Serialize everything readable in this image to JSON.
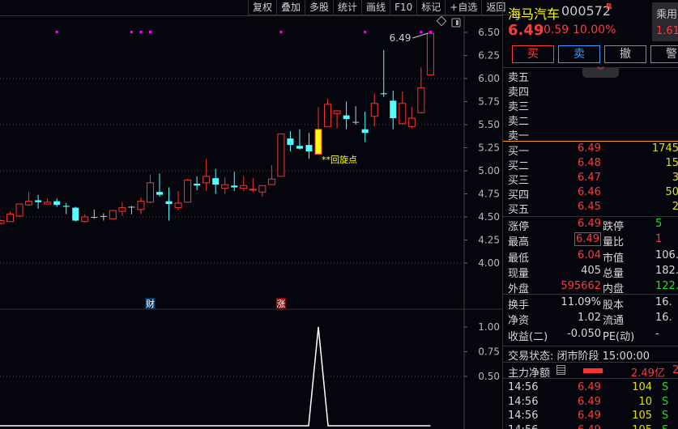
{
  "toolbar": [
    "复权",
    "叠加",
    "多股",
    "统计",
    "画线",
    "F10",
    "标记",
    "+自选",
    "返回"
  ],
  "stock": {
    "name": "海马汽车",
    "code": "000572",
    "flag": "R",
    "price": "6.49",
    "change": "0.59",
    "pct": "10.00%",
    "sector": "乘用",
    "sector_pct": "1.61"
  },
  "actions": {
    "buy": "买",
    "sell": "卖",
    "cancel": "撤",
    "alert": "警"
  },
  "asks": [
    "卖五",
    "卖四",
    "卖三",
    "卖二",
    "卖一"
  ],
  "bids": [
    {
      "label": "买一",
      "price": "6.49",
      "vol": "1745"
    },
    {
      "label": "买二",
      "price": "6.48",
      "vol": "15"
    },
    {
      "label": "买三",
      "price": "6.47",
      "vol": "3"
    },
    {
      "label": "买四",
      "price": "6.46",
      "vol": "50"
    },
    {
      "label": "买五",
      "price": "6.45",
      "vol": "2"
    }
  ],
  "stats1": [
    {
      "l": "涨停",
      "v": "6.49",
      "l2": "跌停",
      "v2": "5"
    },
    {
      "l": "最高",
      "v": "6.49",
      "l2": "量比",
      "v2": "1"
    },
    {
      "l": "最低",
      "v": "6.04",
      "l2": "市值",
      "v2": "106."
    },
    {
      "l": "现量",
      "v": "405",
      "l2": "总量",
      "v2": "182."
    },
    {
      "l": "外盘",
      "v": "595662",
      "l2": "内盘",
      "v2": "122."
    }
  ],
  "stats2": [
    {
      "l": "换手",
      "v": "11.09%",
      "l2": "股本",
      "v2": "16."
    },
    {
      "l": "净资",
      "v": "1.02",
      "l2": "流通",
      "v2": "16."
    },
    {
      "l": "收益(二)",
      "v": "-0.050",
      "l2": "PE(动)",
      "v2": "-"
    }
  ],
  "status": "交易状态: 闭市阶段 15:00:00",
  "mainflow": {
    "label": "主力净额",
    "value": "2.49亿",
    "extra": "2"
  },
  "ticks": [
    {
      "t": "14:56",
      "p": "6.49",
      "v": "104",
      "s": "S"
    },
    {
      "t": "14:56",
      "p": "6.49",
      "v": "10",
      "s": "S"
    },
    {
      "t": "14:56",
      "p": "6.49",
      "v": "105",
      "s": "S"
    },
    {
      "t": "14:56",
      "p": "6.49",
      "v": "105",
      "s": "S"
    }
  ],
  "chart_data": {
    "type": "candlestick",
    "price_axis": {
      "ticks": [
        "6.50",
        "6.25",
        "6.00",
        "5.75",
        "5.50",
        "5.25",
        "5.00",
        "4.75",
        "4.50",
        "4.25",
        "4.00"
      ],
      "range": [
        4.0,
        6.5
      ]
    },
    "last_label": "6.49",
    "annotation": "**回旋点",
    "annotation_index": 34,
    "markers": {
      "cai": "财",
      "zhang": "涨",
      "cai_index": 16,
      "zhang_index": 30
    },
    "dot_indices": [
      6,
      14,
      15,
      16,
      30,
      39,
      45,
      46
    ],
    "candles": [
      [
        4.43,
        4.47,
        4.42,
        4.46
      ],
      [
        4.45,
        4.56,
        4.45,
        4.53
      ],
      [
        4.51,
        4.64,
        4.5,
        4.64
      ],
      [
        4.63,
        4.77,
        4.62,
        4.67
      ],
      [
        4.68,
        4.74,
        4.59,
        4.66
      ],
      [
        4.64,
        4.7,
        4.64,
        4.66
      ],
      [
        4.67,
        4.7,
        4.61,
        4.63
      ],
      [
        4.62,
        4.65,
        4.53,
        4.61
      ],
      [
        4.6,
        4.61,
        4.45,
        4.46
      ],
      [
        4.45,
        4.53,
        4.44,
        4.5
      ],
      [
        4.5,
        4.58,
        4.48,
        4.5
      ],
      [
        4.51,
        4.54,
        4.46,
        4.51
      ],
      [
        4.48,
        4.57,
        4.47,
        4.57
      ],
      [
        4.56,
        4.66,
        4.51,
        4.6
      ],
      [
        4.61,
        4.62,
        4.53,
        4.61
      ],
      [
        4.58,
        4.71,
        4.53,
        4.67
      ],
      [
        4.66,
        4.96,
        4.65,
        4.87
      ],
      [
        4.77,
        4.97,
        4.72,
        4.74
      ],
      [
        4.67,
        4.82,
        4.46,
        4.64
      ],
      [
        4.6,
        4.78,
        4.57,
        4.65
      ],
      [
        4.66,
        4.91,
        4.66,
        4.9
      ],
      [
        4.86,
        4.94,
        4.79,
        4.84
      ],
      [
        4.87,
        5.13,
        4.78,
        4.94
      ],
      [
        4.92,
        5.02,
        4.75,
        4.85
      ],
      [
        4.81,
        4.93,
        4.75,
        4.85
      ],
      [
        4.84,
        4.99,
        4.78,
        4.82
      ],
      [
        4.81,
        4.94,
        4.78,
        4.84
      ],
      [
        4.79,
        4.92,
        4.77,
        4.8
      ],
      [
        4.77,
        4.84,
        4.72,
        4.84
      ],
      [
        4.85,
        5.06,
        4.85,
        4.91
      ],
      [
        4.94,
        5.4,
        4.94,
        5.4
      ],
      [
        5.35,
        5.43,
        5.21,
        5.28
      ],
      [
        5.27,
        5.45,
        5.23,
        5.24
      ],
      [
        5.28,
        5.41,
        5.13,
        5.21
      ],
      [
        5.18,
        5.69,
        5.17,
        5.45
      ],
      [
        5.48,
        5.78,
        5.48,
        5.72
      ],
      [
        5.62,
        5.65,
        5.46,
        5.65
      ],
      [
        5.6,
        5.75,
        5.45,
        5.56
      ],
      [
        5.53,
        5.7,
        5.5,
        5.53
      ],
      [
        5.45,
        5.64,
        5.31,
        5.41
      ],
      [
        5.59,
        5.84,
        5.48,
        5.73
      ],
      [
        5.84,
        6.31,
        5.8,
        5.83
      ],
      [
        5.76,
        5.87,
        5.45,
        5.57
      ],
      [
        5.51,
        5.86,
        5.5,
        5.73
      ],
      [
        5.48,
        5.69,
        5.46,
        5.57
      ],
      [
        5.63,
        6.12,
        5.62,
        5.9
      ],
      [
        6.04,
        6.49,
        6.04,
        6.49
      ]
    ],
    "indicator": {
      "ticks": [
        "1.00",
        "0.75",
        "0.50"
      ],
      "range": [
        0,
        1
      ],
      "spike_index": 34,
      "spike_value": 1.0
    }
  }
}
